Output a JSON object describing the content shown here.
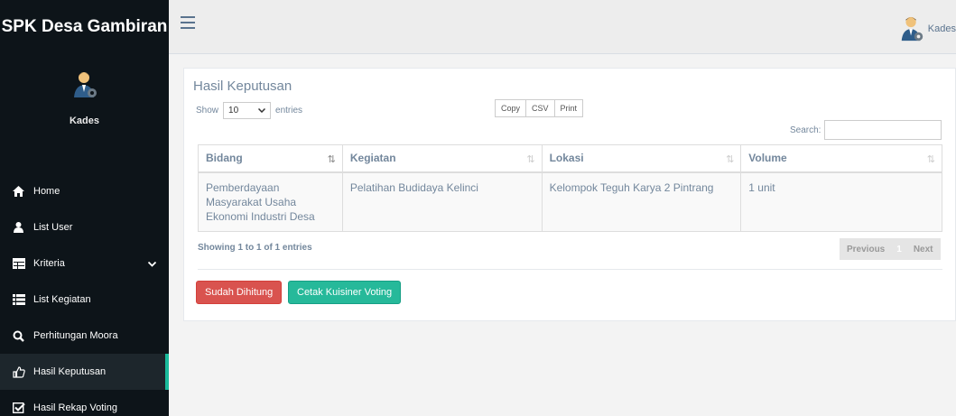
{
  "app": {
    "brand": "SPK Desa Gambiran"
  },
  "user": {
    "name": "Kades"
  },
  "topbar": {
    "user_label": "Kades"
  },
  "sidebar": {
    "items": [
      {
        "label": "Home",
        "icon": "home-icon"
      },
      {
        "label": "List User",
        "icon": "user-icon"
      },
      {
        "label": "Kriteria",
        "icon": "table-icon"
      },
      {
        "label": "List Kegiatan",
        "icon": "list-icon"
      },
      {
        "label": "Perhitungan Moora",
        "icon": "search-icon"
      },
      {
        "label": "Hasil Keputusan",
        "icon": "thumbs-up-icon"
      },
      {
        "label": "Hasil Rekap Voting",
        "icon": "check-square-icon"
      }
    ]
  },
  "panel": {
    "title": "Hasil Keputusan",
    "length": {
      "show": "Show",
      "value": "10",
      "entries": "entries"
    },
    "buttons": {
      "copy": "Copy",
      "csv": "CSV",
      "print": "Print"
    },
    "search_label": "Search:",
    "table": {
      "columns": [
        "Bidang",
        "Kegiatan",
        "Lokasi",
        "Volume"
      ],
      "rows": [
        [
          "Pemberdayaan Masyarakat Usaha Ekonomi Industri Desa",
          "Pelatihan Budidaya Kelinci",
          "Kelompok Teguh Karya 2 Pintrang",
          "1 unit"
        ]
      ]
    },
    "info": "Showing 1 to 1 of 1 entries",
    "pager": {
      "previous": "Previous",
      "current": "1",
      "next": "Next"
    },
    "actions": {
      "done": "Sudah Dihitung",
      "print_voting": "Cetak Kuisiner Voting"
    }
  },
  "colors": {
    "sidebar": "#0d1419",
    "accent": "#1abb9c",
    "danger": "#d9534f",
    "success": "#26b99a"
  }
}
